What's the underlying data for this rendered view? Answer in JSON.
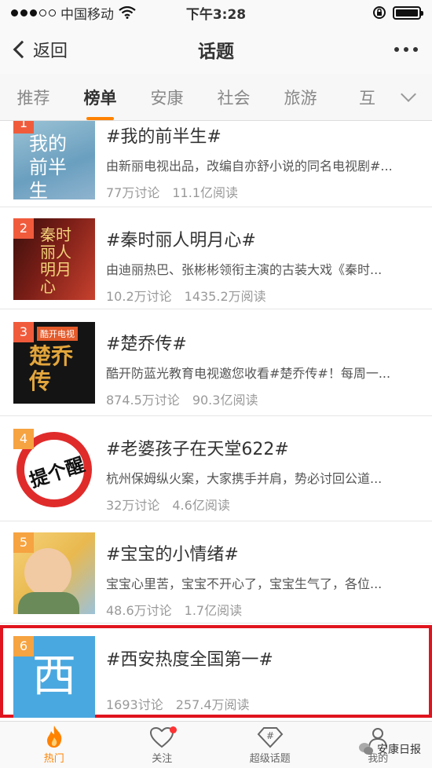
{
  "status": {
    "carrier": "中国移动",
    "time": "下午3:28"
  },
  "nav": {
    "back": "返回",
    "title": "话题"
  },
  "tabs": [
    "推荐",
    "榜单",
    "安康",
    "社会",
    "旅游",
    "互"
  ],
  "topics": [
    {
      "rank": "1",
      "title": "#我的前半生#",
      "desc": "由新丽电视出品，改编自亦舒小说的同名电视剧#...",
      "discuss": "77万讨论",
      "read": "11.1亿阅读",
      "thumb_text": "我的前半生",
      "thumb_colors": [
        "#7fb3c9",
        "#d77b78"
      ]
    },
    {
      "rank": "2",
      "title": "#秦时丽人明月心#",
      "desc": "由迪丽热巴、张彬彬领衔主演的古装大戏《秦时...",
      "discuss": "10.2万讨论",
      "read": "1435.2万阅读",
      "thumb_text": "秦时丽人明月心",
      "thumb_colors": [
        "#5a1a14",
        "#c8412e"
      ]
    },
    {
      "rank": "3",
      "title": "#楚乔传#",
      "desc": "酷开防蓝光教育电视邀您收看#楚乔传#！每周一...",
      "discuss": "874.5万讨论",
      "read": "90.3亿阅读",
      "thumb_text": "楚乔传",
      "badge": "酷开电视",
      "thumb_colors": [
        "#1a1a1a",
        "#e3a63c"
      ]
    },
    {
      "rank": "4",
      "title": "#老婆孩子在天堂622#",
      "desc": "杭州保姆纵火案，大家携手并肩，势必讨回公道...",
      "discuss": "32万讨论",
      "read": "4.6亿阅读",
      "thumb_text": "提个醒",
      "thumb_colors": [
        "#ffffff",
        "#e02b2b"
      ]
    },
    {
      "rank": "5",
      "title": "#宝宝的小情绪#",
      "desc": "宝宝心里苦，宝宝不开心了，宝宝生气了，各位...",
      "discuss": "48.6万讨论",
      "read": "1.7亿阅读",
      "thumb_colors": [
        "#f2c25a",
        "#8ab0c9"
      ]
    },
    {
      "rank": "6",
      "title": "#西安热度全国第一#",
      "desc": "",
      "discuss": "1693讨论",
      "read": "257.4万阅读",
      "thumb_text": "西",
      "thumb_colors": [
        "#4aa8e0",
        "#ffffff"
      ]
    }
  ],
  "bottom_tabs": [
    "热门",
    "关注",
    "超级话题",
    "我的"
  ],
  "watermark": "安康日报",
  "colors": {
    "accent": "#ff8200",
    "rank": "#f05b3c",
    "highlight": "#e0141e"
  }
}
